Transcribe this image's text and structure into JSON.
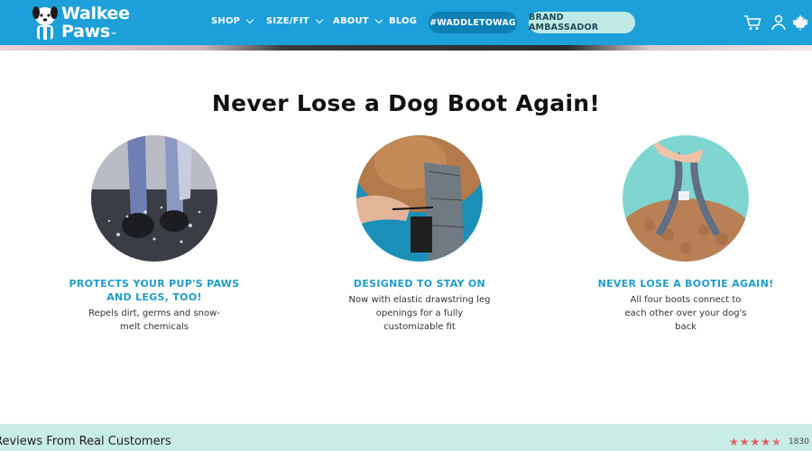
{
  "header": {
    "logo_line1": "Walkee",
    "logo_line2": "Paws",
    "nav": [
      {
        "label": "SHOP",
        "dropdown": true
      },
      {
        "label": "SIZE/FIT",
        "dropdown": true
      },
      {
        "label": "ABOUT",
        "dropdown": true
      },
      {
        "label": "BLOG",
        "dropdown": false
      }
    ],
    "hashtag_button": "#WADDLETOWAG",
    "ambassador_button": "BRAND AMBASSADOR",
    "icons": [
      "cart-icon",
      "account-icon",
      "maple-leaf-icon"
    ],
    "colors": {
      "header_bg": "#1d9fd9",
      "hashtag_bg": "#0c7fb3",
      "ambassador_bg": "#bfe9e6"
    }
  },
  "main": {
    "headline": "Never Lose a Dog Boot Again!",
    "features": [
      {
        "title": "PROTECTS YOUR PUP'S PAWS AND LEGS, TOO!",
        "description": "Repels dirt, germs and snow-melt chemicals",
        "image": "dog legs in boots splashing through puddle"
      },
      {
        "title": "DESIGNED TO STAY ON",
        "description": "Now with elastic drawstring leg openings for a fully customizable fit",
        "image": "hand tightening drawstring on dog boot"
      },
      {
        "title": "NEVER LOSE A BOOTIE AGAIN!",
        "description": "All four boots connect to each other over your dog's back",
        "image": "connected boot straps over curly dog's back"
      }
    ],
    "accent_color": "#1f9ccb"
  },
  "reviews": {
    "title": "Reviews From Real Customers",
    "rating": 4.5,
    "count": "1830",
    "star_color": "#e15b5b",
    "bg_color": "#c8ece6"
  }
}
